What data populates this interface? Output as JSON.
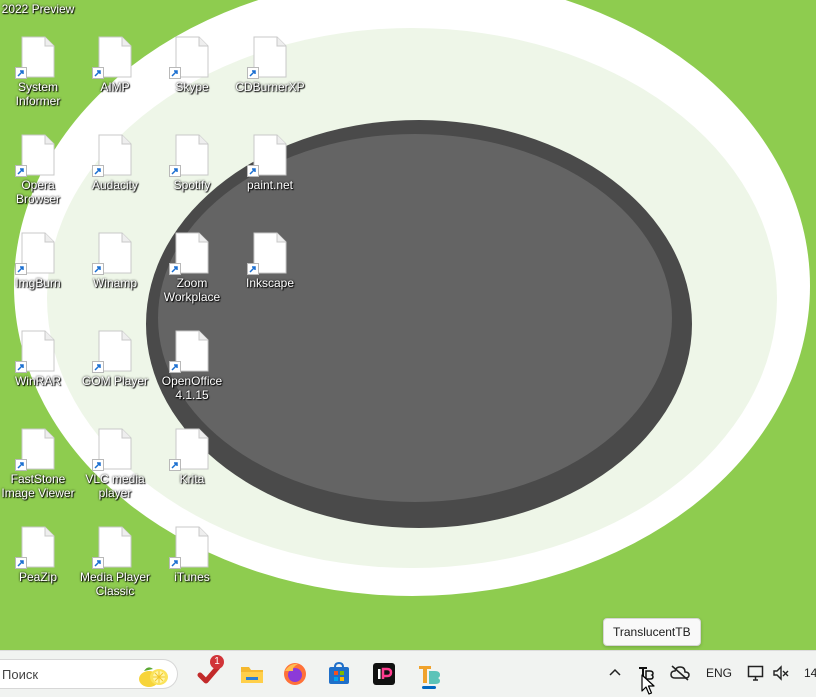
{
  "colors": {
    "wallpaper_green": "#8ecc4f",
    "ring_white": "#ffffff",
    "ring_pale": "#eef6e8",
    "ellipse_dark": "#4a4a4a",
    "ellipse_fill": "#646464",
    "taskbar_bg": "#f1f3f1"
  },
  "desktop": {
    "partial_top_label": "2022 Preview",
    "icons": [
      {
        "label": "System Informer"
      },
      {
        "label": "AIMP"
      },
      {
        "label": "Skype"
      },
      {
        "label": "CDBurnerXP"
      },
      {
        "label": "Opera Browser"
      },
      {
        "label": "Audacity"
      },
      {
        "label": "Spotify"
      },
      {
        "label": "paint.net"
      },
      {
        "label": "ImgBurn"
      },
      {
        "label": "Winamp"
      },
      {
        "label": "Zoom Workplace"
      },
      {
        "label": "Inkscape"
      },
      {
        "label": "WinRAR"
      },
      {
        "label": "GOM Player"
      },
      {
        "label": "OpenOffice 4.1.15"
      },
      {
        "label": "FastStone Image Viewer"
      },
      {
        "label": "VLC media player"
      },
      {
        "label": "Krita"
      },
      {
        "label": "PeaZip"
      },
      {
        "label": "Media Player Classic"
      },
      {
        "label": "iTunes"
      }
    ]
  },
  "tooltip": {
    "text": "TranslucentTB"
  },
  "taskbar": {
    "search_placeholder": "Поиск",
    "apps": [
      {
        "icon": "todo-checkmark-icon",
        "badge": "1"
      },
      {
        "icon": "file-explorer-icon"
      },
      {
        "icon": "firefox-icon"
      },
      {
        "icon": "microsoft-store-icon"
      },
      {
        "icon": "ip-app-icon"
      },
      {
        "icon": "translucenttb-icon"
      }
    ],
    "tray": {
      "overflow_icon": "chevron-up-icon",
      "translucenttb_icon": "translucenttb-tray-icon",
      "network_icon": "cloud-offline-icon",
      "language": "ENG",
      "monitor_icon": "display-icon",
      "volume_icon": "speaker-muted-icon",
      "clock": "14"
    }
  }
}
